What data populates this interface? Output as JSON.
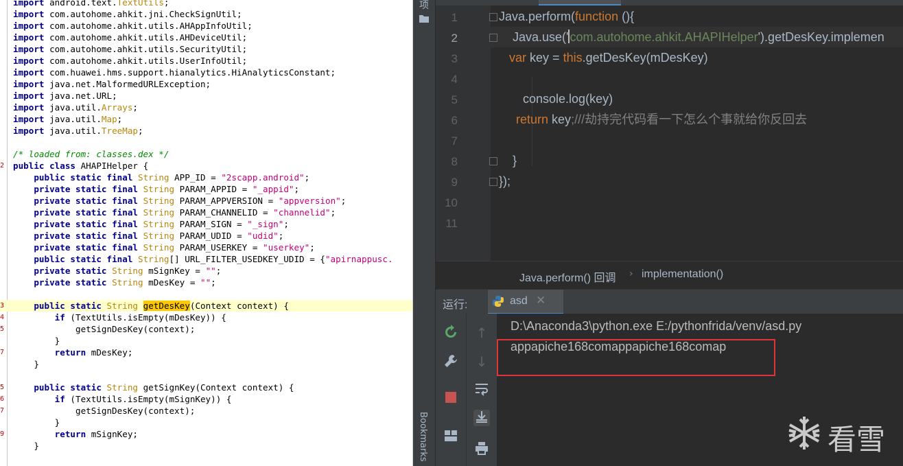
{
  "java": {
    "lines": [
      {
        "g": "",
        "hl": false,
        "parts": [
          {
            "c": "kw",
            "t": "import"
          },
          {
            "c": "",
            "t": " android.text."
          },
          {
            "c": "ty",
            "t": "TextUtils"
          },
          {
            "c": "",
            "t": ";"
          }
        ]
      },
      {
        "g": "",
        "hl": false,
        "parts": [
          {
            "c": "kw",
            "t": "import"
          },
          {
            "c": "",
            "t": " com.autohome.ahkit.jni.CheckSignUtil;"
          }
        ]
      },
      {
        "g": "",
        "hl": false,
        "parts": [
          {
            "c": "kw",
            "t": "import"
          },
          {
            "c": "",
            "t": " com.autohome.ahkit.utils.AHAppInfoUtil;"
          }
        ]
      },
      {
        "g": "",
        "hl": false,
        "parts": [
          {
            "c": "kw",
            "t": "import"
          },
          {
            "c": "",
            "t": " com.autohome.ahkit.utils.AHDeviceUtil;"
          }
        ]
      },
      {
        "g": "",
        "hl": false,
        "parts": [
          {
            "c": "kw",
            "t": "import"
          },
          {
            "c": "",
            "t": " com.autohome.ahkit.utils.SecurityUtil;"
          }
        ]
      },
      {
        "g": "",
        "hl": false,
        "parts": [
          {
            "c": "kw",
            "t": "import"
          },
          {
            "c": "",
            "t": " com.autohome.ahkit.utils.UserInfoUtil;"
          }
        ]
      },
      {
        "g": "",
        "hl": false,
        "parts": [
          {
            "c": "kw",
            "t": "import"
          },
          {
            "c": "",
            "t": " com.huawei.hms.support.hianalytics.HiAnalyticsConstant;"
          }
        ]
      },
      {
        "g": "",
        "hl": false,
        "parts": [
          {
            "c": "kw",
            "t": "import"
          },
          {
            "c": "",
            "t": " java.net.MalformedURLException;"
          }
        ]
      },
      {
        "g": "",
        "hl": false,
        "parts": [
          {
            "c": "kw",
            "t": "import"
          },
          {
            "c": "",
            "t": " java.net.URL;"
          }
        ]
      },
      {
        "g": "",
        "hl": false,
        "parts": [
          {
            "c": "kw",
            "t": "import"
          },
          {
            "c": "",
            "t": " java.util."
          },
          {
            "c": "ty",
            "t": "Arrays"
          },
          {
            "c": "",
            "t": ";"
          }
        ]
      },
      {
        "g": "",
        "hl": false,
        "parts": [
          {
            "c": "kw",
            "t": "import"
          },
          {
            "c": "",
            "t": " java.util."
          },
          {
            "c": "ty",
            "t": "Map"
          },
          {
            "c": "",
            "t": ";"
          }
        ]
      },
      {
        "g": "",
        "hl": false,
        "parts": [
          {
            "c": "kw",
            "t": "import"
          },
          {
            "c": "",
            "t": " java.util."
          },
          {
            "c": "ty",
            "t": "TreeMap"
          },
          {
            "c": "",
            "t": ";"
          }
        ]
      },
      {
        "g": "",
        "hl": false,
        "parts": []
      },
      {
        "g": "",
        "hl": false,
        "parts": [
          {
            "c": "cm",
            "t": "/* loaded from: classes.dex */"
          }
        ]
      },
      {
        "g": "2",
        "hl": false,
        "parts": [
          {
            "c": "kw",
            "t": "public class"
          },
          {
            "c": "",
            "t": " AHAPIHelper {"
          }
        ]
      },
      {
        "g": "",
        "hl": false,
        "parts": [
          {
            "c": "",
            "t": "    "
          },
          {
            "c": "kw",
            "t": "public static final"
          },
          {
            "c": "",
            "t": " "
          },
          {
            "c": "ty",
            "t": "String"
          },
          {
            "c": "",
            "t": " APP_ID = "
          },
          {
            "c": "str",
            "t": "\"2scapp.android\""
          },
          {
            "c": "",
            "t": ";"
          }
        ]
      },
      {
        "g": "",
        "hl": false,
        "parts": [
          {
            "c": "",
            "t": "    "
          },
          {
            "c": "kw",
            "t": "private static final"
          },
          {
            "c": "",
            "t": " "
          },
          {
            "c": "ty",
            "t": "String"
          },
          {
            "c": "",
            "t": " PARAM_APPID = "
          },
          {
            "c": "str",
            "t": "\"_appid\""
          },
          {
            "c": "",
            "t": ";"
          }
        ]
      },
      {
        "g": "",
        "hl": false,
        "parts": [
          {
            "c": "",
            "t": "    "
          },
          {
            "c": "kw",
            "t": "private static final"
          },
          {
            "c": "",
            "t": " "
          },
          {
            "c": "ty",
            "t": "String"
          },
          {
            "c": "",
            "t": " PARAM_APPVERSION = "
          },
          {
            "c": "str",
            "t": "\"appversion\""
          },
          {
            "c": "",
            "t": ";"
          }
        ]
      },
      {
        "g": "",
        "hl": false,
        "parts": [
          {
            "c": "",
            "t": "    "
          },
          {
            "c": "kw",
            "t": "private static final"
          },
          {
            "c": "",
            "t": " "
          },
          {
            "c": "ty",
            "t": "String"
          },
          {
            "c": "",
            "t": " PARAM_CHANNELID = "
          },
          {
            "c": "str",
            "t": "\"channelid\""
          },
          {
            "c": "",
            "t": ";"
          }
        ]
      },
      {
        "g": "",
        "hl": false,
        "parts": [
          {
            "c": "",
            "t": "    "
          },
          {
            "c": "kw",
            "t": "private static final"
          },
          {
            "c": "",
            "t": " "
          },
          {
            "c": "ty",
            "t": "String"
          },
          {
            "c": "",
            "t": " PARAM_SIGN = "
          },
          {
            "c": "str",
            "t": "\"_sign\""
          },
          {
            "c": "",
            "t": ";"
          }
        ]
      },
      {
        "g": "",
        "hl": false,
        "parts": [
          {
            "c": "",
            "t": "    "
          },
          {
            "c": "kw",
            "t": "private static final"
          },
          {
            "c": "",
            "t": " "
          },
          {
            "c": "ty",
            "t": "String"
          },
          {
            "c": "",
            "t": " PARAM_UDID = "
          },
          {
            "c": "str",
            "t": "\"udid\""
          },
          {
            "c": "",
            "t": ";"
          }
        ]
      },
      {
        "g": "",
        "hl": false,
        "parts": [
          {
            "c": "",
            "t": "    "
          },
          {
            "c": "kw",
            "t": "private static final"
          },
          {
            "c": "",
            "t": " "
          },
          {
            "c": "ty",
            "t": "String"
          },
          {
            "c": "",
            "t": " PARAM_USERKEY = "
          },
          {
            "c": "str",
            "t": "\"userkey\""
          },
          {
            "c": "",
            "t": ";"
          }
        ]
      },
      {
        "g": "",
        "hl": false,
        "parts": [
          {
            "c": "",
            "t": "    "
          },
          {
            "c": "kw",
            "t": "public static final"
          },
          {
            "c": "",
            "t": " "
          },
          {
            "c": "ty",
            "t": "String"
          },
          {
            "c": "",
            "t": "[] URL_FILTER_USEDKEY_UDID = {"
          },
          {
            "c": "str",
            "t": "\"apirnappusc."
          }
        ]
      },
      {
        "g": "",
        "hl": false,
        "parts": [
          {
            "c": "",
            "t": "    "
          },
          {
            "c": "kw",
            "t": "private static"
          },
          {
            "c": "",
            "t": " "
          },
          {
            "c": "ty",
            "t": "String"
          },
          {
            "c": "",
            "t": " mSignKey = "
          },
          {
            "c": "str",
            "t": "\"\""
          },
          {
            "c": "",
            "t": ";"
          }
        ]
      },
      {
        "g": "",
        "hl": false,
        "parts": [
          {
            "c": "",
            "t": "    "
          },
          {
            "c": "kw",
            "t": "private static"
          },
          {
            "c": "",
            "t": " "
          },
          {
            "c": "ty",
            "t": "String"
          },
          {
            "c": "",
            "t": " mDesKey = "
          },
          {
            "c": "str",
            "t": "\"\""
          },
          {
            "c": "",
            "t": ";"
          }
        ]
      },
      {
        "g": "",
        "hl": false,
        "parts": []
      },
      {
        "g": "3",
        "hl": true,
        "parts": [
          {
            "c": "",
            "t": "    "
          },
          {
            "c": "kw",
            "t": "public static"
          },
          {
            "c": "",
            "t": " "
          },
          {
            "c": "ty",
            "t": "String"
          },
          {
            "c": "",
            "t": " "
          },
          {
            "c": "mk",
            "t": "getDesKey"
          },
          {
            "c": "",
            "t": "(Context context) {"
          }
        ]
      },
      {
        "g": "4",
        "hl": false,
        "parts": [
          {
            "c": "",
            "t": "        "
          },
          {
            "c": "kw",
            "t": "if"
          },
          {
            "c": "",
            "t": " (TextUtils.isEmpty(mDesKey)) {"
          }
        ]
      },
      {
        "g": "5",
        "hl": false,
        "parts": [
          {
            "c": "",
            "t": "            getSignDesKey(context);"
          }
        ]
      },
      {
        "g": "",
        "hl": false,
        "parts": [
          {
            "c": "",
            "t": "        }"
          }
        ]
      },
      {
        "g": "7",
        "hl": false,
        "parts": [
          {
            "c": "",
            "t": "        "
          },
          {
            "c": "kw",
            "t": "return"
          },
          {
            "c": "",
            "t": " mDesKey;"
          }
        ]
      },
      {
        "g": "",
        "hl": false,
        "parts": [
          {
            "c": "",
            "t": "    }"
          }
        ]
      },
      {
        "g": "",
        "hl": false,
        "parts": []
      },
      {
        "g": "5",
        "hl": false,
        "parts": [
          {
            "c": "",
            "t": "    "
          },
          {
            "c": "kw",
            "t": "public static"
          },
          {
            "c": "",
            "t": " "
          },
          {
            "c": "ty",
            "t": "String"
          },
          {
            "c": "",
            "t": " getSignKey(Context context) {"
          }
        ]
      },
      {
        "g": "6",
        "hl": false,
        "parts": [
          {
            "c": "",
            "t": "        "
          },
          {
            "c": "kw",
            "t": "if"
          },
          {
            "c": "",
            "t": " (TextUtils.isEmpty(mSignKey)) {"
          }
        ]
      },
      {
        "g": "7",
        "hl": false,
        "parts": [
          {
            "c": "",
            "t": "            getSignDesKey(context);"
          }
        ]
      },
      {
        "g": "",
        "hl": false,
        "parts": [
          {
            "c": "",
            "t": "        }"
          }
        ]
      },
      {
        "g": "9",
        "hl": false,
        "parts": [
          {
            "c": "",
            "t": "        "
          },
          {
            "c": "kw",
            "t": "return"
          },
          {
            "c": "",
            "t": " mSignKey;"
          }
        ]
      },
      {
        "g": "",
        "hl": false,
        "parts": [
          {
            "c": "",
            "t": "    }"
          }
        ]
      }
    ]
  },
  "editor": {
    "line_numbers": [
      "1",
      "2",
      "3",
      "4",
      "5",
      "6",
      "7",
      "8",
      "9",
      "10",
      "11"
    ],
    "current_line": "2",
    "lines": [
      [
        {
          "c": "",
          "t": "Java.perform("
        },
        {
          "c": "fn",
          "t": "function"
        },
        {
          "c": "",
          "t": " (){"
        }
      ],
      [
        {
          "c": "",
          "t": "    Java.use('"
        },
        {
          "c": "es",
          "t": "com.autohome.ahkit.AHAPIHelper"
        },
        {
          "c": "",
          "t": "').getDesKey.implemen"
        }
      ],
      [
        {
          "c": "",
          "t": "   "
        },
        {
          "c": "kjs",
          "t": "var"
        },
        {
          "c": "",
          "t": " key = "
        },
        {
          "c": "kjs",
          "t": "this"
        },
        {
          "c": "",
          "t": ".getDesKey(mDesKey)"
        }
      ],
      [],
      [
        {
          "c": "",
          "t": "       console.log(key)"
        }
      ],
      [
        {
          "c": "",
          "t": "     "
        },
        {
          "c": "kjs",
          "t": "return"
        },
        {
          "c": "",
          "t": " key"
        },
        {
          "c": "gr",
          "t": ";///劫持完代码看一下怎么个事就给你反回去"
        }
      ],
      [],
      [
        {
          "c": "",
          "t": "    }"
        }
      ],
      [
        {
          "c": "",
          "t": "});"
        }
      ],
      [],
      []
    ]
  },
  "breadcrumb": {
    "item1": "Java.perform() 回调",
    "separator": "›",
    "item2": "implementation()"
  },
  "run": {
    "label": "运行:",
    "tab_name": "asd",
    "close": "✕"
  },
  "console": {
    "line1": "D:\\Anaconda3\\python.exe E:/pythonfrida/venv/asd.py",
    "line2": "appapiche168comappapiche168comap"
  },
  "side": {
    "bookmarks": "Bookmarks",
    "top_label": "项"
  },
  "watermark": {
    "text": "看雪"
  },
  "colors": {
    "highlight_bg": "#ffffcc",
    "match_bg": "#ffc800",
    "annotation_red": "#e0343b",
    "ide_bg": "#2b2b2b"
  }
}
